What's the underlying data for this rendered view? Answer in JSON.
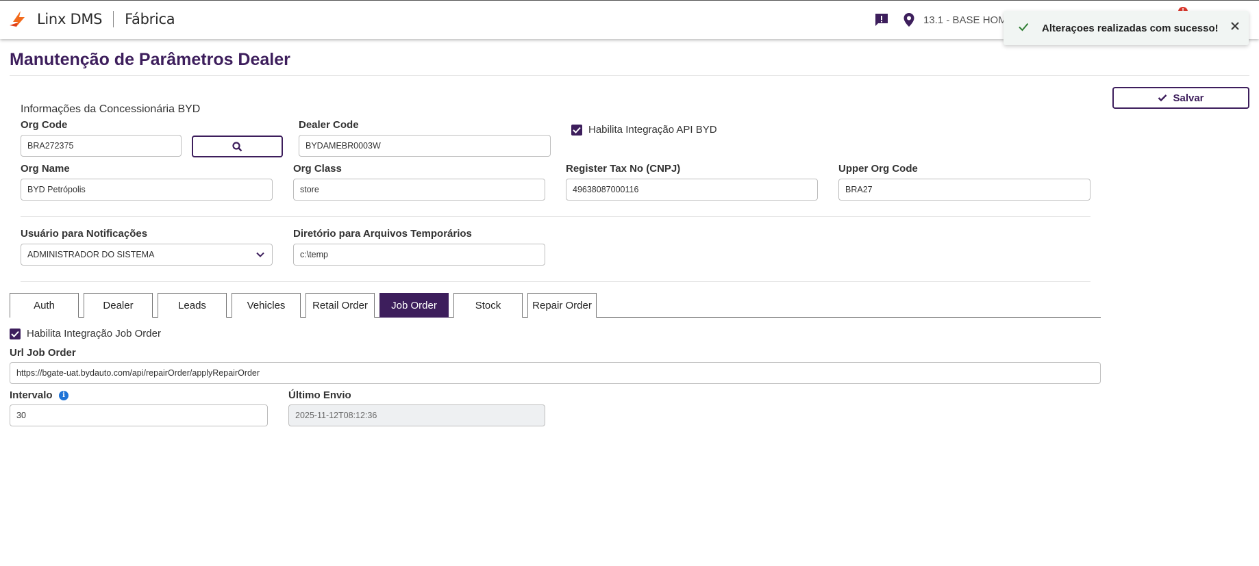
{
  "header": {
    "app_name": "Linx DMS",
    "module": "Fábrica",
    "branch": "13.1 - BASE HOMO",
    "notification_count": "!"
  },
  "toast": {
    "message": "Alteraçoes realizadas com sucesso!",
    "status_color": "#2e7d32"
  },
  "page": {
    "title": "Manutenção de Parâmetros Dealer",
    "save_label": "Salvar"
  },
  "dealer_info": {
    "section_title": "Informações da Concessionária BYD",
    "org_code": {
      "label": "Org Code",
      "value": "BRA272375"
    },
    "dealer_code": {
      "label": "Dealer Code",
      "value": "BYDAMEBR0003W"
    },
    "api_integration": {
      "label": "Habilita Integração API BYD",
      "checked": true
    },
    "org_name": {
      "label": "Org Name",
      "value": "BYD Petrópolis"
    },
    "org_class": {
      "label": "Org Class",
      "value": "store"
    },
    "tax_no": {
      "label": "Register Tax No (CNPJ)",
      "value": "49638087000116"
    },
    "upper_org_code": {
      "label": "Upper Org Code",
      "value": "BRA27"
    }
  },
  "settings": {
    "notif_user": {
      "label": "Usuário para Notificações",
      "value": "ADMINISTRADOR DO SISTEMA"
    },
    "temp_dir": {
      "label": "Diretório para Arquivos Temporários",
      "value": "c:\\temp"
    }
  },
  "tabs": [
    {
      "label": "Auth",
      "active": false
    },
    {
      "label": "Dealer",
      "active": false
    },
    {
      "label": "Leads",
      "active": false
    },
    {
      "label": "Vehicles",
      "active": false
    },
    {
      "label": "Retail Order",
      "active": false
    },
    {
      "label": "Job Order",
      "active": true
    },
    {
      "label": "Stock",
      "active": false
    },
    {
      "label": "Repair Order",
      "active": false
    }
  ],
  "job_order": {
    "enable": {
      "label": "Habilita Integração Job Order",
      "checked": true
    },
    "url": {
      "label": "Url Job Order",
      "value": "https://bgate-uat.bydauto.com/api/repairOrder/applyRepairOrder"
    },
    "interval": {
      "label": "Intervalo",
      "value": "30"
    },
    "last_sent": {
      "label": "Último Envio",
      "value": "2025-11-12T08:12:36"
    }
  },
  "colors": {
    "brand_purple": "#3d1e5c",
    "logo_orange": "#f26a1b",
    "info_blue": "#1e73d6",
    "alert_red": "#d9362b"
  },
  "icons": [
    "linx-logo-icon",
    "chat-alert-icon",
    "location-pin-icon",
    "check-icon",
    "close-icon",
    "search-icon",
    "chevron-down-icon",
    "checkbox-checked-icon",
    "info-icon"
  ]
}
